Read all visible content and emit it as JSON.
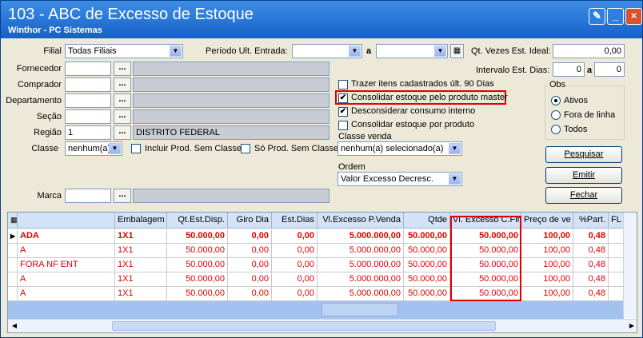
{
  "window": {
    "title": "103 - ABC de Excesso de Estoque",
    "subtitle": "Winthor - PC Sistemas"
  },
  "form": {
    "filial_label": "Filial",
    "filial_value": "Todas Filiais",
    "periodo_label": "Período Ult. Entrada:",
    "periodo_sep": "a",
    "qt_vezes_label": "Qt. Vezes Est. Ideal:",
    "qt_vezes_value": "0,00",
    "intervalo_label": "Intervalo Est. Dias:",
    "intervalo_from": "0",
    "intervalo_sep": "a",
    "intervalo_to": "0",
    "fornecedor_label": "Fornecedor",
    "comprador_label": "Comprador",
    "departamento_label": "Departamento",
    "secao_label": "Seção",
    "regiao_label": "Região",
    "regiao_code": "1",
    "regiao_desc": "DISTRITO FEDERAL",
    "classe_label": "Classe",
    "classe_value": "nenhum(a)",
    "incluir_sem_classe": "Incluir Prod. Sem Classe",
    "so_sem_classe": "Só Prod. Sem Classe",
    "marca_label": "Marca",
    "dots": "..."
  },
  "options": {
    "trazer_itens": "Trazer itens cadastrados últ. 90 Dias",
    "consolidar_master": "Consolidar estoque pelo produto master",
    "desconsiderar": "Desconsiderar consumo interno",
    "consolidar_produto": "Consolidar estoque por produto",
    "classe_venda_label": "Classe venda",
    "classe_venda_value": "nenhum(a) selecionado(a)",
    "ordem_label": "Ordem",
    "ordem_value": "Valor Excesso Decresc."
  },
  "obs": {
    "label": "Obs",
    "ativos": "Ativos",
    "fora_linha": "Fora de linha",
    "todos": "Todos"
  },
  "buttons": {
    "pesquisar": "Pesquisar",
    "emitir": "Emitir",
    "fechar": "Fechar"
  },
  "grid": {
    "headers": [
      "",
      "Embalagem",
      "Qt.Est.Disp.",
      "Giro Dia",
      "Est.Dias",
      "Vl.Excesso P.Venda",
      "Qtde",
      "Vl. Excesso C.Fin",
      "Preço de ve",
      "%Part.",
      "FL"
    ],
    "rows": [
      [
        "ADA",
        "1X1",
        "50.000,00",
        "0,00",
        "0,00",
        "5.000.000,00",
        "50.000,00",
        "50.000,00",
        "100,00",
        "0,48",
        ""
      ],
      [
        "A",
        "1X1",
        "50.000,00",
        "0,00",
        "0,00",
        "5.000.000,00",
        "50.000,00",
        "50.000,00",
        "100,00",
        "0,48",
        ""
      ],
      [
        "FORA NF ENT",
        "1X1",
        "50.000,00",
        "0,00",
        "0,00",
        "5.000.000,00",
        "50.000,00",
        "50.000,00",
        "100,00",
        "0,48",
        ""
      ],
      [
        "A",
        "1X1",
        "50.000,00",
        "0,00",
        "0,00",
        "5.000.000,00",
        "50.000,00",
        "50.000,00",
        "100,00",
        "0,48",
        ""
      ],
      [
        "A",
        "1X1",
        "50.000,00",
        "0,00",
        "0,00",
        "5.000.000,00",
        "50.000,00",
        "50.000,00",
        "100,00",
        "0,48",
        ""
      ]
    ]
  },
  "colors": {
    "title_bar": "#1660c8",
    "highlight": "#e00000",
    "grid_header": "#d4e2f7"
  }
}
